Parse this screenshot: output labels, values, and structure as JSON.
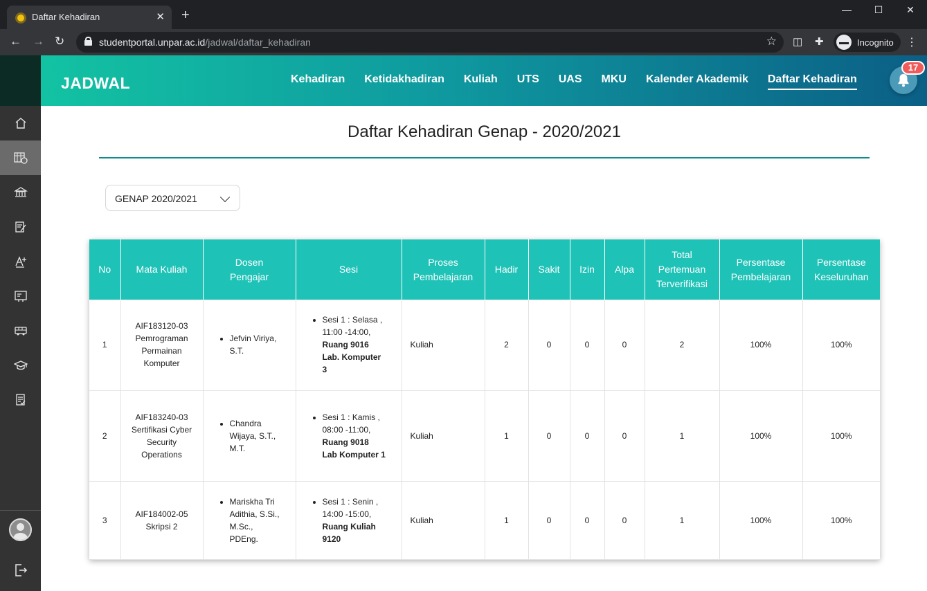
{
  "browser": {
    "tab_title": "Daftar Kehadiran",
    "url_domain": "studentportal.unpar.ac.id",
    "url_path": "/jadwal/daftar_kehadiran",
    "profile_label": "Incognito"
  },
  "header": {
    "brand": "JADWAL",
    "nav": [
      {
        "label": "Kehadiran"
      },
      {
        "label": "Ketidakhadiran"
      },
      {
        "label": "Kuliah"
      },
      {
        "label": "UTS"
      },
      {
        "label": "UAS"
      },
      {
        "label": "MKU"
      },
      {
        "label": "Kalender Akademik"
      },
      {
        "label": "Daftar Kehadiran"
      }
    ],
    "active_nav": "Daftar Kehadiran",
    "notification_count": "17"
  },
  "page": {
    "title": "Daftar Kehadiran Genap - 2020/2021",
    "semester_select": "GENAP 2020/2021"
  },
  "table": {
    "headers": [
      "No",
      "Mata Kuliah",
      "Dosen Pengajar",
      "Sesi",
      "Proses Pembelajaran",
      "Hadir",
      "Sakit",
      "Izin",
      "Alpa",
      "Total Pertemuan Terverifikasi",
      "Persentase Pembelajaran",
      "Persentase Keseluruhan"
    ],
    "rows": [
      {
        "no": "1",
        "mata_kuliah_code": "AIF183120-03",
        "mata_kuliah_name": "Pemrograman Permainan Komputer",
        "dosen": "Jefvin Viriya, S.T.",
        "sesi_time": "Sesi 1 : Selasa , 11:00 -14:00,",
        "sesi_room": "Ruang 9016 Lab. Komputer 3",
        "proses": "Kuliah",
        "hadir": "2",
        "sakit": "0",
        "izin": "0",
        "alpa": "0",
        "total": "2",
        "persen_pembelajaran": "100%",
        "persen_keseluruhan": "100%"
      },
      {
        "no": "2",
        "mata_kuliah_code": "AIF183240-03",
        "mata_kuliah_name": "Sertifikasi Cyber Security Operations",
        "dosen": "Chandra Wijaya, S.T., M.T.",
        "sesi_time": "Sesi 1 : Kamis , 08:00 -11:00,",
        "sesi_room": "Ruang 9018 Lab Komputer 1",
        "proses": "Kuliah",
        "hadir": "1",
        "sakit": "0",
        "izin": "0",
        "alpa": "0",
        "total": "1",
        "persen_pembelajaran": "100%",
        "persen_keseluruhan": "100%"
      },
      {
        "no": "3",
        "mata_kuliah_code": "AIF184002-05",
        "mata_kuliah_name": "Skripsi 2",
        "dosen": "Mariskha Tri Adithia, S.Si., M.Sc., PDEng.",
        "sesi_time": "Sesi 1 : Senin , 14:00 -15:00,",
        "sesi_room": "Ruang Kuliah 9120",
        "proses": "Kuliah",
        "hadir": "1",
        "sakit": "0",
        "izin": "0",
        "alpa": "0",
        "total": "1",
        "persen_pembelajaran": "100%",
        "persen_keseluruhan": "100%"
      }
    ]
  },
  "sidebar_icons": [
    "home-icon",
    "schedule-icon",
    "finance-icon",
    "edit-form-icon",
    "grade-icon",
    "presentation-icon",
    "bus-icon",
    "graduation-cap-icon",
    "checklist-icon"
  ],
  "colors": {
    "accent": "#1fc2b7",
    "header_start": "#13c5a3",
    "header_end": "#0b5f86",
    "badge": "#f05a5a"
  }
}
